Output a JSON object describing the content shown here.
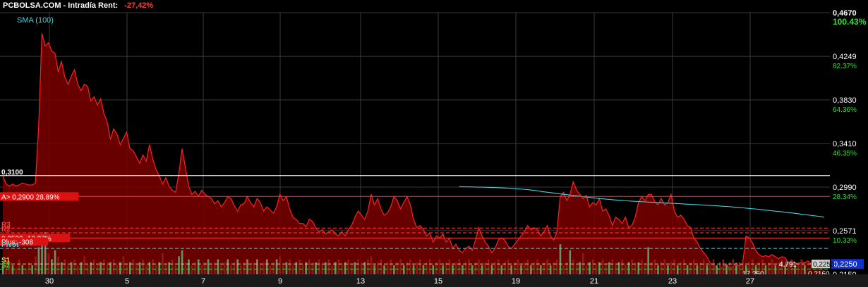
{
  "header": {
    "title": "PCBOLSA.COM - Intradía  Rent:",
    "rent": "-27,42%"
  },
  "indicator_label": "SMA (100)",
  "colors": {
    "price": "#ff2020",
    "price_fill": "#7a0000",
    "sma": "#39d6e0",
    "grid": "#3a3a3a",
    "vol_up": "#6b8f6b",
    "vol_down": "#8b1a1a",
    "green_text": "#33dd33",
    "red_text": "#ff3b3b"
  },
  "chart_data": {
    "type": "area",
    "x_tick_labels": [
      "30",
      "5",
      "7",
      "9",
      "13",
      "15",
      "19",
      "21",
      "23",
      "27"
    ],
    "y_ticks": [
      {
        "price": "0,4670",
        "pct": "100.43%"
      },
      {
        "price": "0,4249",
        "pct": "82.37%"
      },
      {
        "price": "0,3830",
        "pct": "64.36%"
      },
      {
        "price": "0,3410",
        "pct": "46.35%"
      },
      {
        "price": "0,2990",
        "pct": "28.34%"
      },
      {
        "price": "0,2571",
        "pct": "10.33%"
      },
      {
        "price": "0,2150",
        "pct": "-7.73%"
      }
    ],
    "ylim": [
      0.215,
      0.467
    ],
    "current_price": "0,2250",
    "low_price": "0,2160",
    "prices": [
      0.31,
      0.302,
      0.3,
      0.302,
      0.3,
      0.301,
      0.303,
      0.302,
      0.301,
      0.301,
      0.303,
      0.358,
      0.447,
      0.435,
      0.438,
      0.43,
      0.428,
      0.41,
      0.42,
      0.405,
      0.398,
      0.406,
      0.412,
      0.398,
      0.392,
      0.398,
      0.396,
      0.382,
      0.386,
      0.378,
      0.384,
      0.37,
      0.362,
      0.345,
      0.355,
      0.35,
      0.34,
      0.346,
      0.352,
      0.336,
      0.334,
      0.328,
      0.322,
      0.33,
      0.324,
      0.34,
      0.326,
      0.316,
      0.31,
      0.302,
      0.308,
      0.3,
      0.296,
      0.294,
      0.312,
      0.336,
      0.318,
      0.3,
      0.292,
      0.295,
      0.29,
      0.296,
      0.292,
      0.29,
      0.288,
      0.283,
      0.286,
      0.28,
      0.284,
      0.29,
      0.288,
      0.281,
      0.276,
      0.282,
      0.283,
      0.29,
      0.284,
      0.28,
      0.288,
      0.284,
      0.276,
      0.28,
      0.277,
      0.274,
      0.28,
      0.292,
      0.286,
      0.29,
      0.278,
      0.27,
      0.268,
      0.264,
      0.264,
      0.261,
      0.268,
      0.266,
      0.26,
      0.256,
      0.258,
      0.254,
      0.256,
      0.258,
      0.254,
      0.252,
      0.256,
      0.252,
      0.258,
      0.262,
      0.27,
      0.276,
      0.272,
      0.268,
      0.276,
      0.292,
      0.282,
      0.288,
      0.278,
      0.272,
      0.274,
      0.28,
      0.29,
      0.286,
      0.278,
      0.284,
      0.29,
      0.282,
      0.268,
      0.26,
      0.262,
      0.258,
      0.252,
      0.255,
      0.246,
      0.252,
      0.25,
      0.254,
      0.246,
      0.25,
      0.24,
      0.244,
      0.238,
      0.236,
      0.24,
      0.242,
      0.238,
      0.248,
      0.26,
      0.252,
      0.246,
      0.242,
      0.236,
      0.24,
      0.248,
      0.25,
      0.248,
      0.242,
      0.24,
      0.244,
      0.248,
      0.252,
      0.256,
      0.262,
      0.258,
      0.26,
      0.258,
      0.252,
      0.256,
      0.262,
      0.252,
      0.248,
      0.256,
      0.29,
      0.294,
      0.286,
      0.292,
      0.304,
      0.296,
      0.292,
      0.288,
      0.291,
      0.28,
      0.284,
      0.282,
      0.288,
      0.276,
      0.278,
      0.272,
      0.262,
      0.27,
      0.268,
      0.264,
      0.27,
      0.26,
      0.262,
      0.27,
      0.284,
      0.29,
      0.286,
      0.292,
      0.292,
      0.285,
      0.282,
      0.288,
      0.282,
      0.284,
      0.292,
      0.276,
      0.27,
      0.272,
      0.268,
      0.262,
      0.26,
      0.25,
      0.246,
      0.24,
      0.236,
      0.232,
      0.226,
      0.224,
      0.221,
      0.22,
      0.222,
      0.225,
      0.22,
      0.223,
      0.226,
      0.222,
      0.226,
      0.252,
      0.25,
      0.245,
      0.238,
      0.234,
      0.232,
      0.233,
      0.232,
      0.234,
      0.232,
      0.23,
      0.232,
      0.231,
      0.226,
      0.228,
      0.226,
      0.225,
      0.227,
      0.226,
      0.228,
      0.225,
      0.226,
      0.227,
      0.225,
      0.226
    ],
    "sma_values": [
      0.2994,
      0.2993,
      0.2992,
      0.2991,
      0.2989,
      0.2988,
      0.2986,
      0.2984,
      0.2981,
      0.2978,
      0.2974,
      0.297,
      0.2965,
      0.2958,
      0.295,
      0.2942,
      0.2935,
      0.2928,
      0.2921,
      0.2914,
      0.2908,
      0.2901,
      0.2894,
      0.2888,
      0.2881,
      0.2876,
      0.2871,
      0.2866,
      0.2862,
      0.2858,
      0.2854,
      0.2851,
      0.2848,
      0.2845,
      0.2842,
      0.2839,
      0.2836,
      0.2833,
      0.283,
      0.2827,
      0.2824,
      0.2821,
      0.2818,
      0.2815,
      0.2812,
      0.2808,
      0.2804,
      0.28,
      0.2795,
      0.279,
      0.2785,
      0.278,
      0.2774,
      0.2768,
      0.2762,
      0.2756,
      0.275,
      0.2744,
      0.2737,
      0.273,
      0.2723,
      0.2716,
      0.2709,
      0.2702
    ],
    "sma_start_index": 140,
    "volumes": [
      3,
      2,
      4,
      3,
      2,
      5,
      3,
      2,
      4,
      3,
      6,
      9,
      12,
      14,
      7,
      5,
      8,
      6,
      4,
      5,
      3,
      4,
      5,
      3,
      4,
      6,
      3,
      4,
      5,
      3,
      4,
      5,
      3,
      4,
      5,
      3,
      4,
      6,
      3,
      4,
      5,
      3,
      4,
      5,
      3,
      4,
      5,
      3,
      4,
      7,
      3,
      4,
      5,
      3,
      6,
      8,
      4,
      5,
      3,
      4,
      5,
      3,
      4,
      5,
      3,
      4,
      5,
      3,
      4,
      5,
      3,
      4,
      5,
      3,
      4,
      5,
      3,
      4,
      5,
      3,
      4,
      5,
      3,
      4,
      5,
      6,
      3,
      4,
      5,
      3,
      4,
      5,
      3,
      4,
      5,
      3,
      4,
      5,
      3,
      4,
      5,
      3,
      4,
      5,
      3,
      4,
      5,
      3,
      4,
      5,
      3,
      4,
      5,
      6,
      3,
      4,
      5,
      3,
      4,
      5,
      3,
      4,
      5,
      3,
      4,
      5,
      3,
      4,
      5,
      3,
      4,
      5,
      3,
      4,
      5,
      3,
      4,
      5,
      3,
      4,
      5,
      3,
      4,
      5,
      3,
      4,
      5,
      3,
      4,
      5,
      3,
      4,
      5,
      3,
      4,
      5,
      3,
      4,
      5,
      3,
      4,
      5,
      3,
      4,
      5,
      3,
      4,
      5,
      3,
      4,
      5,
      10,
      3,
      4,
      8,
      5,
      3,
      4,
      7,
      3,
      4,
      5,
      3,
      4,
      5,
      3,
      4,
      5,
      3,
      4,
      5,
      3,
      4,
      5,
      3,
      4,
      5,
      3,
      9,
      4,
      5,
      3,
      4,
      5,
      3,
      4,
      5,
      3,
      4,
      5,
      3,
      4,
      5,
      3,
      4,
      5,
      3,
      4,
      5,
      3,
      4,
      5,
      3,
      4,
      5,
      3,
      4,
      5,
      3,
      4,
      5,
      3,
      4,
      5,
      3,
      4,
      5,
      3,
      4,
      5,
      3,
      4,
      5,
      3,
      4,
      5,
      3
    ],
    "volume_colors": "alternating",
    "levels": [
      {
        "name": "0,3100",
        "value": 0.31,
        "color": "#ffffff",
        "style": "solid"
      },
      {
        "name": "A> 0,2900  28,89%",
        "value": 0.29,
        "color": "#ff3b3b",
        "style": "solid",
        "box": true
      },
      {
        "name": "R3",
        "value": 0.2595,
        "color": "#ff3b3b",
        "style": "dashed"
      },
      {
        "name": "R2",
        "value": 0.255,
        "color": "#ff3b3b",
        "style": "dashed"
      },
      {
        "name": "0,2500  -10,27%",
        "value": 0.25,
        "color": "#ff3b3b",
        "style": "solid",
        "box": true
      },
      {
        "name": "Plus: -308",
        "value": 0.2465,
        "color": "#ff3b3b",
        "style": "none",
        "box": true
      },
      {
        "name": "Pivot",
        "value": 0.24,
        "color": "#39d6e0",
        "style": "dashed"
      },
      {
        "name": "S1",
        "value": 0.225,
        "color": "#e6e640",
        "style": "dashed"
      },
      {
        "name": "S2",
        "value": 0.22,
        "color": "#33dd33",
        "style": "dashed"
      }
    ],
    "annotations": [
      "4.791",
      "17.250"
    ]
  }
}
